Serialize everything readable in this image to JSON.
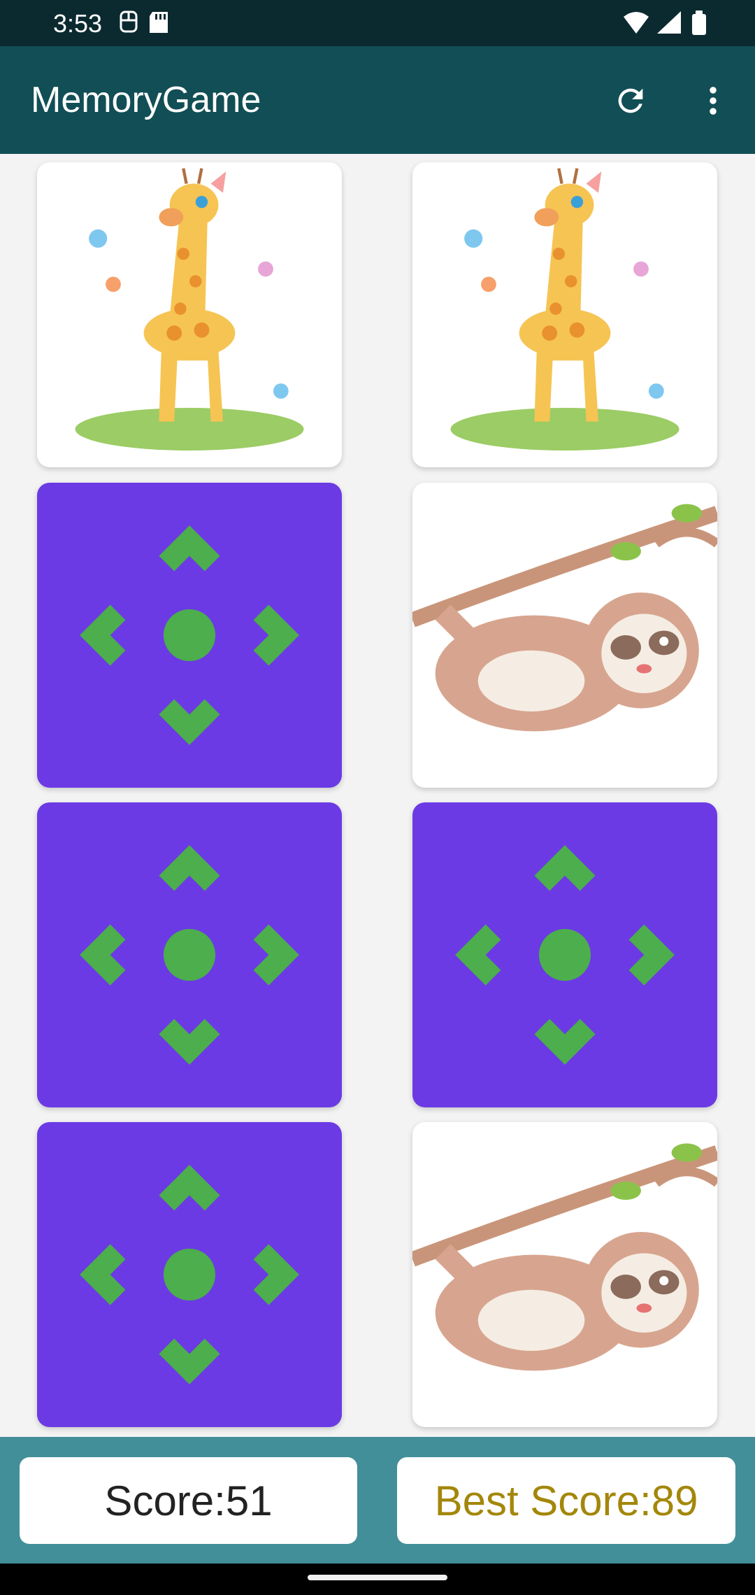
{
  "status_bar": {
    "time": "3:53",
    "left_icons": [
      "accessibility-icon",
      "sd-card-icon"
    ],
    "right_icons": [
      "wifi-icon",
      "signal-icon",
      "battery-icon"
    ]
  },
  "app_bar": {
    "title": "MemoryGame",
    "actions": [
      "refresh-icon",
      "more-vert-icon"
    ],
    "color": "#124e55"
  },
  "board": {
    "rows": 4,
    "columns": 2,
    "cards": [
      {
        "state": "face-up",
        "image": "giraffe"
      },
      {
        "state": "face-up",
        "image": "giraffe"
      },
      {
        "state": "face-down",
        "image": "card-back-arrows"
      },
      {
        "state": "face-up",
        "image": "sloth"
      },
      {
        "state": "face-down",
        "image": "card-back-arrows"
      },
      {
        "state": "face-down",
        "image": "card-back-arrows"
      },
      {
        "state": "face-down",
        "image": "card-back-arrows"
      },
      {
        "state": "face-up",
        "image": "sloth"
      }
    ],
    "card_back_color": "#6b3ae4",
    "card_back_symbol_color": "#4cae4c"
  },
  "scores": {
    "score_label": "Score:51",
    "best_score_label": "Best Score:89",
    "best_score_color": "#a3870a"
  }
}
